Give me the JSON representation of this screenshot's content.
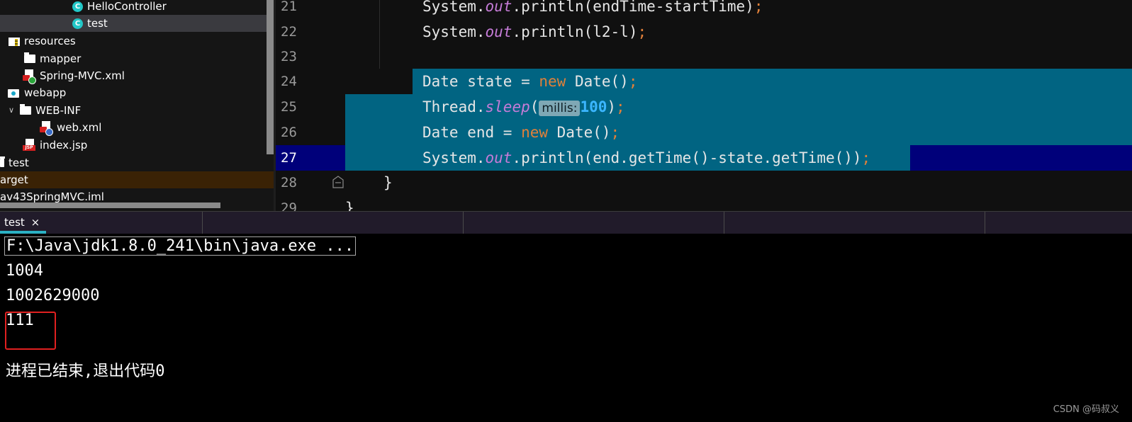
{
  "project_tree": {
    "items": [
      {
        "label": "HelloController",
        "icon": "class-icon"
      },
      {
        "label": "test",
        "icon": "class-icon",
        "selected": true
      },
      {
        "label": "resources",
        "icon": "resources-folder-icon"
      },
      {
        "label": "mapper",
        "icon": "folder-icon"
      },
      {
        "label": "Spring-MVC.xml",
        "icon": "spring-xml-icon"
      },
      {
        "label": "webapp",
        "icon": "web-folder-icon"
      },
      {
        "label": "WEB-INF",
        "icon": "folder-icon",
        "expanded": true
      },
      {
        "label": "web.xml",
        "icon": "web-xml-icon"
      },
      {
        "label": "index.jsp",
        "icon": "jsp-icon"
      },
      {
        "label": "test",
        "icon": "folder-icon"
      },
      {
        "label": "arget",
        "icon": "excluded-folder"
      },
      {
        "label": "av43SpringMVC.iml",
        "icon": "module-file"
      }
    ]
  },
  "editor": {
    "lines": [
      {
        "num": "21",
        "parts": [
          "System.",
          "out",
          ".println(endTime-startTime)",
          ";"
        ]
      },
      {
        "num": "22",
        "parts": [
          "System.",
          "out",
          ".println(l2-l)",
          ";"
        ]
      },
      {
        "num": "23"
      },
      {
        "num": "24",
        "parts": [
          "Date state = ",
          "new",
          " Date()",
          ";"
        ]
      },
      {
        "num": "25",
        "parts": [
          "Thread.",
          "sleep",
          "(",
          "millis:",
          "100",
          ")",
          ";"
        ]
      },
      {
        "num": "26",
        "parts": [
          "Date end = ",
          "new",
          " Date()",
          ";"
        ]
      },
      {
        "num": "27",
        "parts": [
          "System.",
          "out",
          ".println(end.getTime()-state.getTime())",
          ";"
        ]
      },
      {
        "num": "28",
        "text": "}"
      },
      {
        "num": "29",
        "text": "}"
      }
    ]
  },
  "run_panel": {
    "tab_label": "test",
    "tab_close": "×",
    "console_lines": [
      "F:\\Java\\jdk1.8.0_241\\bin\\java.exe ...",
      "1004",
      "1002629000",
      "111",
      "进程已结束,退出代码0"
    ]
  },
  "watermark": "CSDN @码叔义",
  "colors": {
    "selection": "#016482",
    "caret_line": "#00007a",
    "keyword": "#e0803a",
    "static_field": "#c67cd8",
    "number": "#3bb6ff",
    "annotation_box": "#e02020"
  }
}
